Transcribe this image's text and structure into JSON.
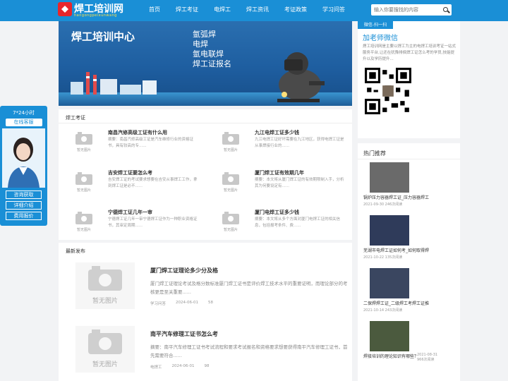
{
  "header": {
    "logo_text": "焊工培训网",
    "logo_sub": "hangongpeixunwang",
    "nav": [
      "首页",
      "焊工考证",
      "电焊工",
      "焊工资讯",
      "考证政策",
      "学习问答"
    ],
    "search_placeholder": "输入你要搜找的内容"
  },
  "banner": {
    "title": "焊工培训中心",
    "items": [
      "氩弧焊",
      "电焊",
      "氩电联焊",
      "焊工证报名"
    ]
  },
  "exam_section": {
    "title": "焊工考证",
    "no_image_label": "暂无图片",
    "cards": [
      {
        "title": "南昌汽修高级工证有什么用",
        "desc": "摘要：南昌汽修高级工证是汽车维修行业的资格证书，具有较高的专......"
      },
      {
        "title": "九江电焊工证多少钱",
        "desc": "九江电焊工证好坏需要在九江地区，获得电焊工证是从事焊接行业的......"
      },
      {
        "title": "吉安焊工证要怎么考",
        "desc": "吉安焊工证的考试要求想要在吉安从事焊工工作，拿到焊工证是必不......"
      },
      {
        "title": "厦门焊工证有效期几年",
        "desc": "摘要：本文将从厦门焊工证的有效期限制入手，分析其为何要设定有......"
      },
      {
        "title": "宁德焊工证几年一审",
        "desc": "宁德焊工证几年一审宁德焊工证作为一种职业资格证书，其审定周期......"
      },
      {
        "title": "厦门电焊工证多少钱",
        "desc": "摘要：本文将从多个方面对厦门电焊工证的相关信息，包括报考条件、费......"
      }
    ]
  },
  "latest_section": {
    "title": "最新发布",
    "no_image_label": "暂无图片",
    "items": [
      {
        "title": "厦门焊工证理论多少分及格",
        "desc": "厦门焊工证理论考试及格分数标准厦门焊工证书是评价焊工技术水平的重要证明，而理论部分的考核更是至关重要......",
        "category": "学习问答",
        "date": "2024-06-01",
        "views": "58"
      },
      {
        "title": "南平汽车修理工证书怎么考",
        "desc": "摘要：南平汽车修理工证书考试流程和要求考试报名和资格要求想要获得南平汽车修理工证书，首先需要符合......",
        "category": "电焊工",
        "date": "2024-06-01",
        "views": "98"
      }
    ]
  },
  "sidebar": {
    "wechat_tag": "微信-扫一扫",
    "wechat_title": "加老师微信",
    "wechat_desc": "焊工培训网是主要以焊工为主的电焊工培训考证一站式服务平台,让还在犹豫排徊焊工证怎么考的学员,技能提升以及学历提升...",
    "hot_title": "热门推荐",
    "hot": [
      {
        "caption": "锅炉压力容器焊工证_压力容器焊工",
        "date": "2021-09-30",
        "views": "246次阅读"
      },
      {
        "caption": "芜湖市电焊工证如何考_如何取得焊",
        "date": "2021-10-22",
        "views": "135次阅读"
      },
      {
        "caption": "二保焊焊工证_二级焊工考焊工证推",
        "date": "2021-10-14",
        "views": "243次阅读"
      },
      {
        "caption": "焊接培训的理论知识有哪些？",
        "date": "2021-08-31",
        "views": "966次阅读"
      }
    ]
  },
  "service": {
    "hours": "7*24小时",
    "online": "在线客服",
    "buttons": [
      "咨询获取",
      "详细介绍",
      "费用报价"
    ]
  },
  "colors": {
    "primary": "#1a8fd6",
    "logo_red": "#e8262b"
  }
}
